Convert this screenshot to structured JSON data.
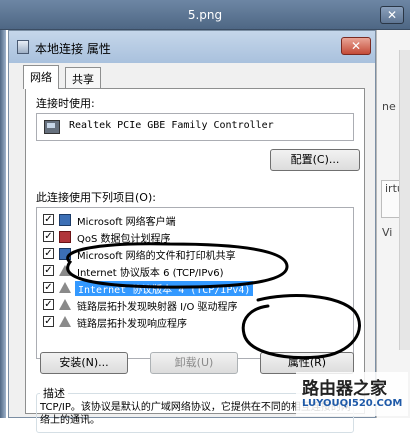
{
  "viewer": {
    "title": "5.png",
    "close_glyph": "✕",
    "bg_fragments": [
      "ne",
      "irtu",
      "Vi"
    ]
  },
  "dialog": {
    "title": "本地连接 属性",
    "close_glyph": "✕",
    "tabs": [
      {
        "label": "网络",
        "active": true
      },
      {
        "label": "共享",
        "active": false
      }
    ],
    "connect_using_label": "连接时使用:",
    "adapter": "Realtek PCIe GBE Family Controller",
    "configure_button": "配置(C)...",
    "items_label": "此连接使用下列项目(O):",
    "items": [
      {
        "label": "Microsoft 网络客户端",
        "checked": true,
        "icon": "network-client-icon"
      },
      {
        "label": "QoS 数据包计划程序",
        "checked": true,
        "icon": "qos-icon"
      },
      {
        "label": "Microsoft 网络的文件和打印机共享",
        "checked": true,
        "icon": "file-share-icon"
      },
      {
        "label": "Internet 协议版本 6 (TCP/IPv6)",
        "checked": true,
        "icon": "protocol-icon"
      },
      {
        "label": "Internet 协议版本 4 (TCP/IPv4)",
        "checked": true,
        "icon": "protocol-icon",
        "selected": true
      },
      {
        "label": "链路层拓扑发现映射器 I/O 驱动程序",
        "checked": true,
        "icon": "protocol-icon"
      },
      {
        "label": "链路层拓扑发现响应程序",
        "checked": true,
        "icon": "protocol-icon"
      }
    ],
    "install_button": "安装(N)...",
    "uninstall_button": "卸载(U)",
    "properties_button": "属性(R)",
    "description_title": "描述",
    "description_text": "TCP/IP。该协议是默认的广域网络协议，它提供在不同的相互连接的网络上的通讯。"
  },
  "watermark": {
    "name": "路由器之家",
    "url": "LUYOUQI520.COM"
  },
  "annotation_color": "#000000"
}
